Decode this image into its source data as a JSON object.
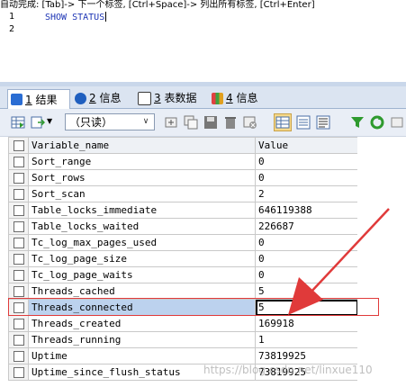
{
  "hint_text": "自动完成: [Tab]-> 下一个标签, [Ctrl+Space]-> 列出所有标签, [Ctrl+Enter]",
  "editor": {
    "line_numbers": [
      "1",
      "2"
    ],
    "code": "SHOW STATUS"
  },
  "tabs": [
    {
      "num": "1",
      "label": "结果",
      "icon": "grid-icon",
      "color": "#2a6dd3"
    },
    {
      "num": "2",
      "label": "信息",
      "icon": "info-icon",
      "color": "#1f5fbf"
    },
    {
      "num": "3",
      "label": "表数据",
      "icon": "table-icon",
      "color": "#3a3a3a"
    },
    {
      "num": "4",
      "label": "信息",
      "icon": "chart-icon",
      "color": "#e0a020"
    }
  ],
  "toolbar": {
    "mode_select": "（只读）"
  },
  "grid": {
    "headers": [
      "Variable_name",
      "Value"
    ],
    "rows": [
      [
        "Sort_range",
        "0"
      ],
      [
        "Sort_rows",
        "0"
      ],
      [
        "Sort_scan",
        "2"
      ],
      [
        "Table_locks_immediate",
        "646119388"
      ],
      [
        "Table_locks_waited",
        "226687"
      ],
      [
        "Tc_log_max_pages_used",
        "0"
      ],
      [
        "Tc_log_page_size",
        "0"
      ],
      [
        "Tc_log_page_waits",
        "0"
      ],
      [
        "Threads_cached",
        "5"
      ],
      [
        "Threads_connected",
        "5"
      ],
      [
        "Threads_created",
        "169918"
      ],
      [
        "Threads_running",
        "1"
      ],
      [
        "Uptime",
        "73819925"
      ],
      [
        "Uptime_since_flush_status",
        "73819925"
      ]
    ],
    "selected_row": 9
  },
  "watermark": "https://blog.csdn.net/linxue110",
  "colors": {
    "highlight": "#bcd2ee",
    "annotation_red": "#e03a3a"
  }
}
